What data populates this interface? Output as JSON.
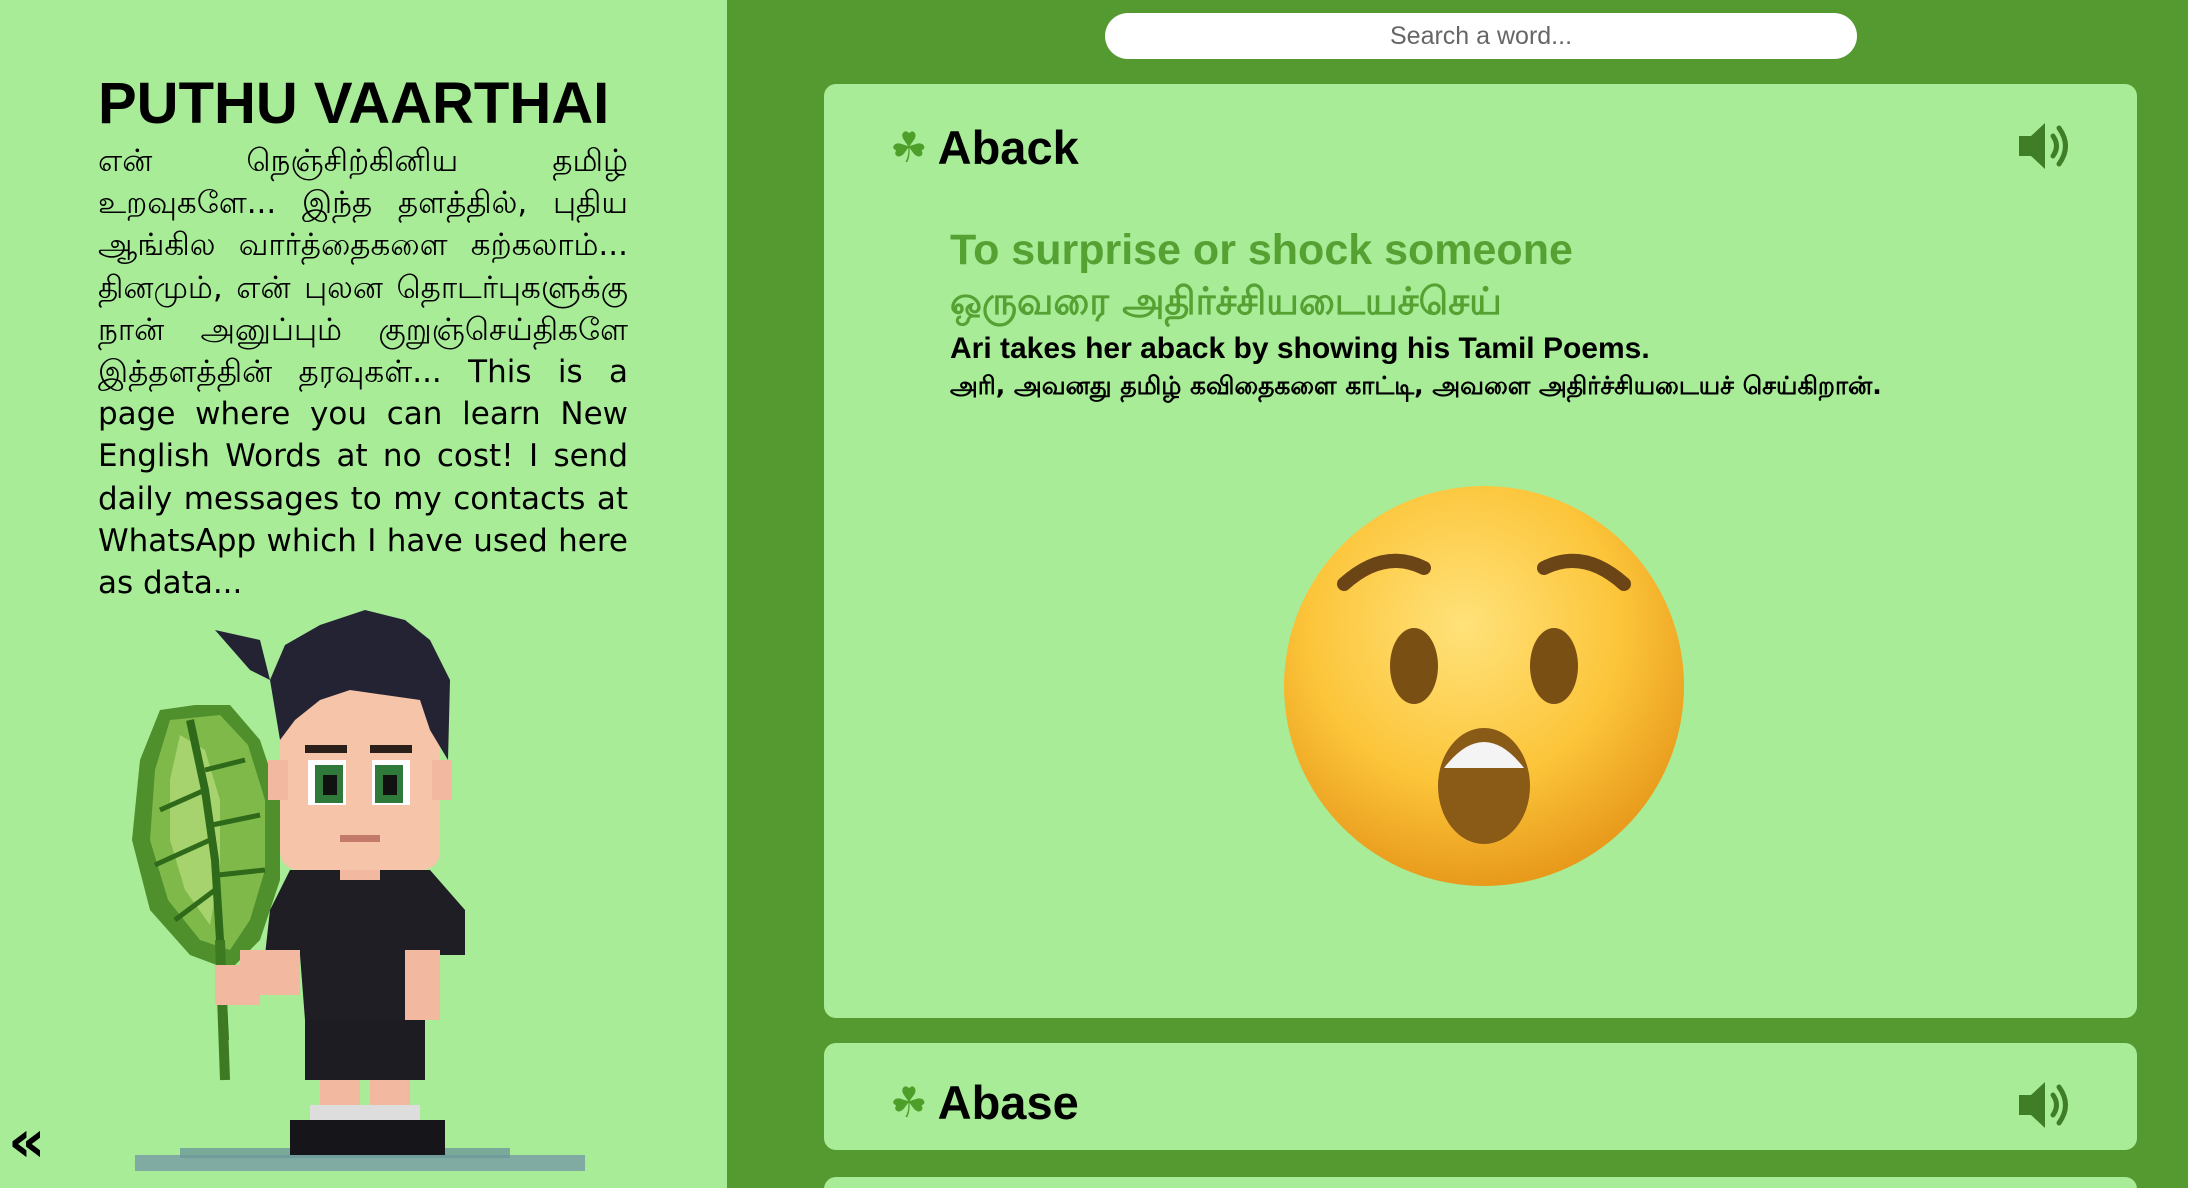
{
  "sidebar": {
    "title": "PUTHU VAARTHAI",
    "intro": "என் நெஞ்சிற்கினிய தமிழ் உறவுகளே... இந்த தளத்தில், புதிய ஆங்கில வார்த்தைகளை கற்கலாம்... தினமும், என் புலன தொடர்புகளுக்கு நான் அனுப்பும் குறுஞ்செய்திகளே இத்தளத்தின் தரவுகள்... This is a page where you can learn New English Words at no cost! I send daily messages to my contacts at WhatsApp which I have used here as data...",
    "collapse_label": "«"
  },
  "search": {
    "placeholder": "Search a word..."
  },
  "cards": [
    {
      "icon": "shamrock-icon",
      "word": "Aback",
      "meaning_en": "To surprise or shock someone",
      "meaning_ta": "ஒருவரை அதிர்ச்சியடையச்செய்",
      "example_en": "Ari takes her aback by showing his Tamil Poems.",
      "example_ta": "அரி, அவனது தமிழ் கவிதைகளை காட்டி, அவளை அதிர்ச்சியடையச் செய்கிறான்.",
      "illustration": "astonished-face-emoji",
      "expanded": true
    },
    {
      "icon": "shamrock-icon",
      "word": "Abase",
      "expanded": false
    }
  ],
  "colors": {
    "page_bg": "#549a30",
    "panel_bg": "#a8ec98",
    "accent_green": "#55a233"
  }
}
